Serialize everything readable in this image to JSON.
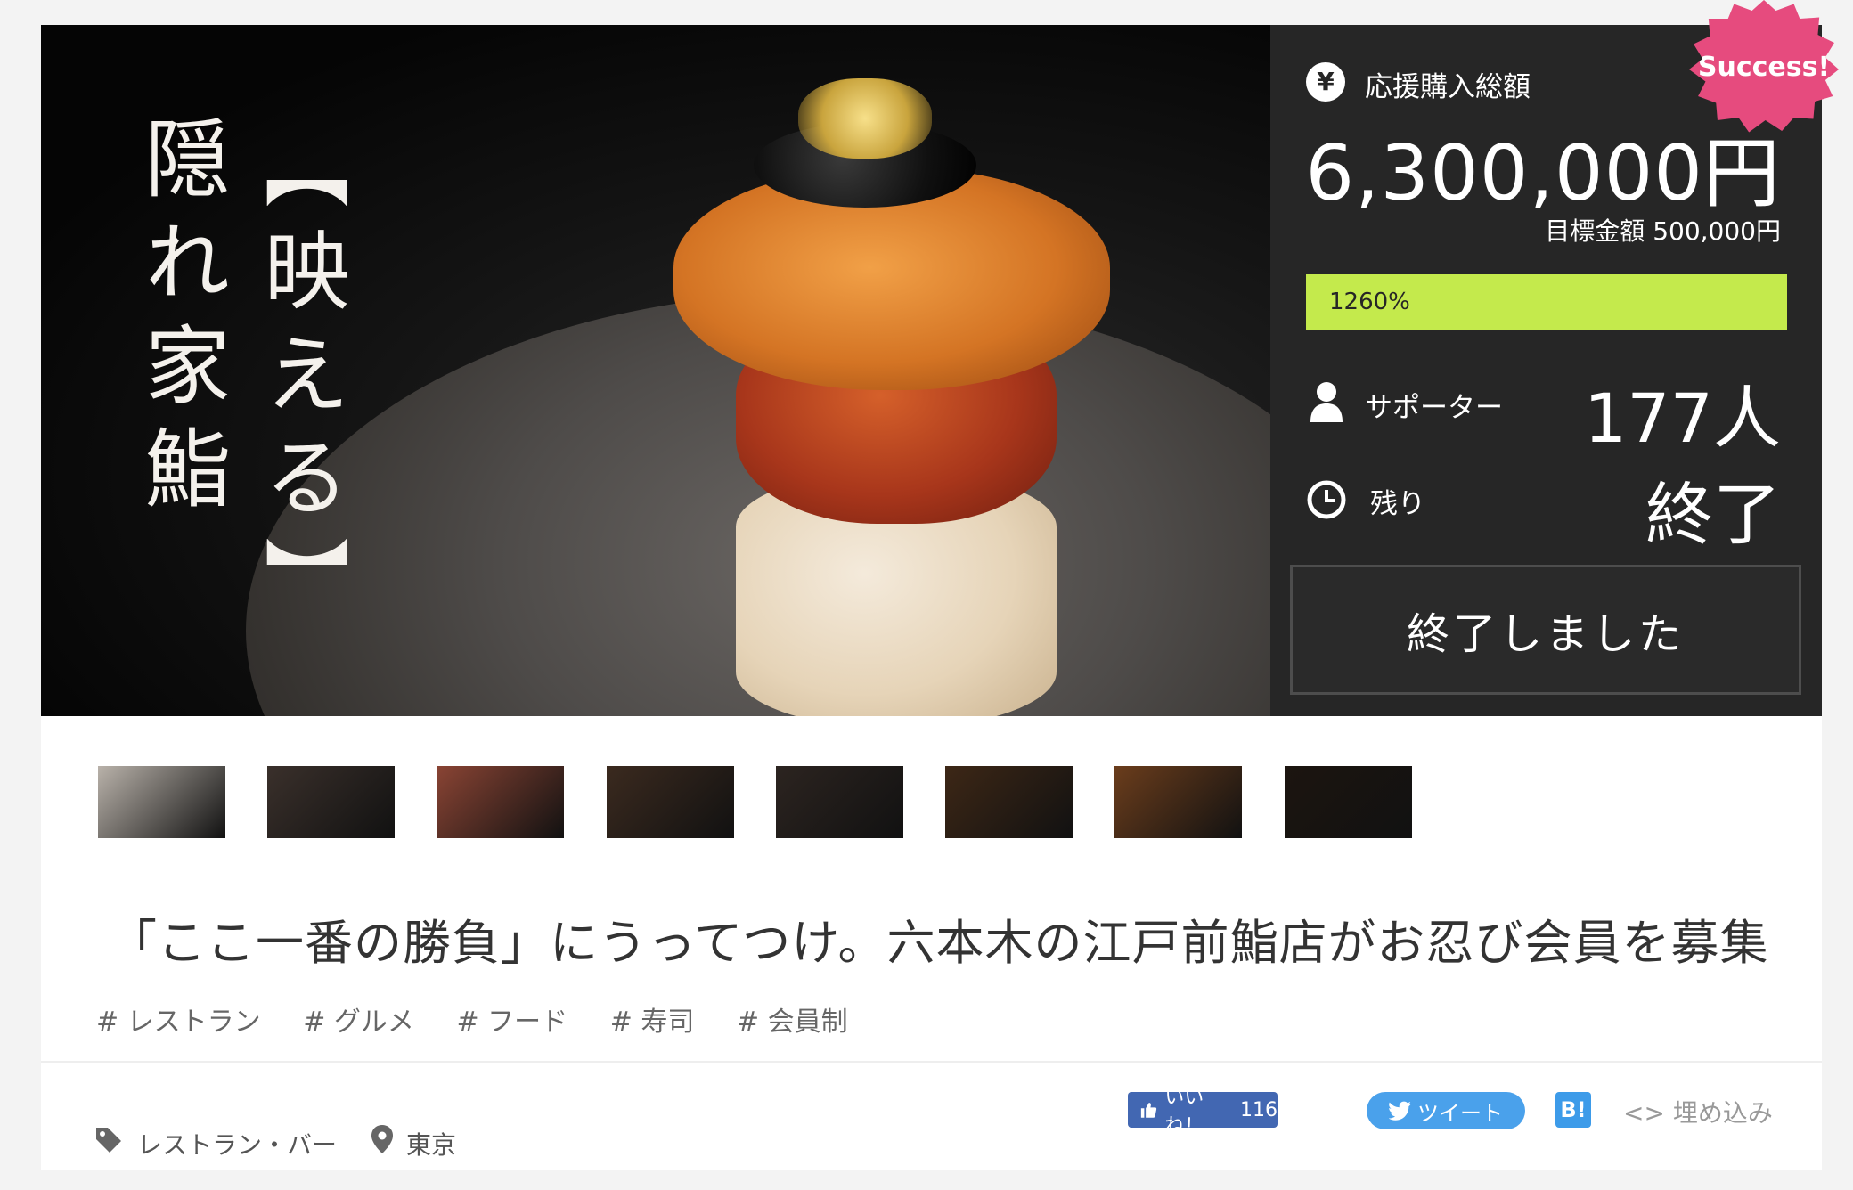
{
  "hero": {
    "title_line1": "隠れ家鮨",
    "title_line2": "【映える】"
  },
  "panel": {
    "total_label": "応援購入総額",
    "total_amount": "6,300,000円",
    "goal_text": "目標金額 500,000円",
    "progress_percent": 1260,
    "progress_label": "1260%",
    "supporters_label": "サポーター",
    "supporters_value": "177人",
    "remaining_label": "残り",
    "remaining_value": "終了",
    "ended_button": "終了しました",
    "badge": "Success!"
  },
  "thumbnails": [
    {
      "name": "thumb-hero",
      "color": "#b9b2aa"
    },
    {
      "name": "thumb-hands-sushi",
      "color": "#3a302b"
    },
    {
      "name": "thumb-nigiri",
      "color": "#8a4434"
    },
    {
      "name": "thumb-counter",
      "color": "#3b2a1f"
    },
    {
      "name": "thumb-pouring",
      "color": "#2c2420"
    },
    {
      "name": "thumb-corridor",
      "color": "#3d2716"
    },
    {
      "name": "thumb-dining-room",
      "color": "#6b3d1c"
    },
    {
      "name": "thumb-entrance",
      "color": "#1c1510"
    }
  ],
  "headline": "「ここ一番の勝負」にうってつけ。六本木の江戸前鮨店がお忍び会員を募集",
  "tags": [
    "# レストラン",
    "# グルメ",
    "# フード",
    "# 寿司",
    "# 会員制"
  ],
  "footer": {
    "category": "レストラン・バー",
    "location": "東京",
    "fb_label": "いいね！",
    "fb_count": "116",
    "tweet_label": "ツイート",
    "hatena_label": "B!",
    "embed_label": "埋め込み"
  },
  "colors": {
    "panel_bg": "#262626",
    "progress": "#c4ea4c",
    "badge": "#e64b7e",
    "facebook": "#4267b2",
    "twitter": "#4aa1eb"
  }
}
